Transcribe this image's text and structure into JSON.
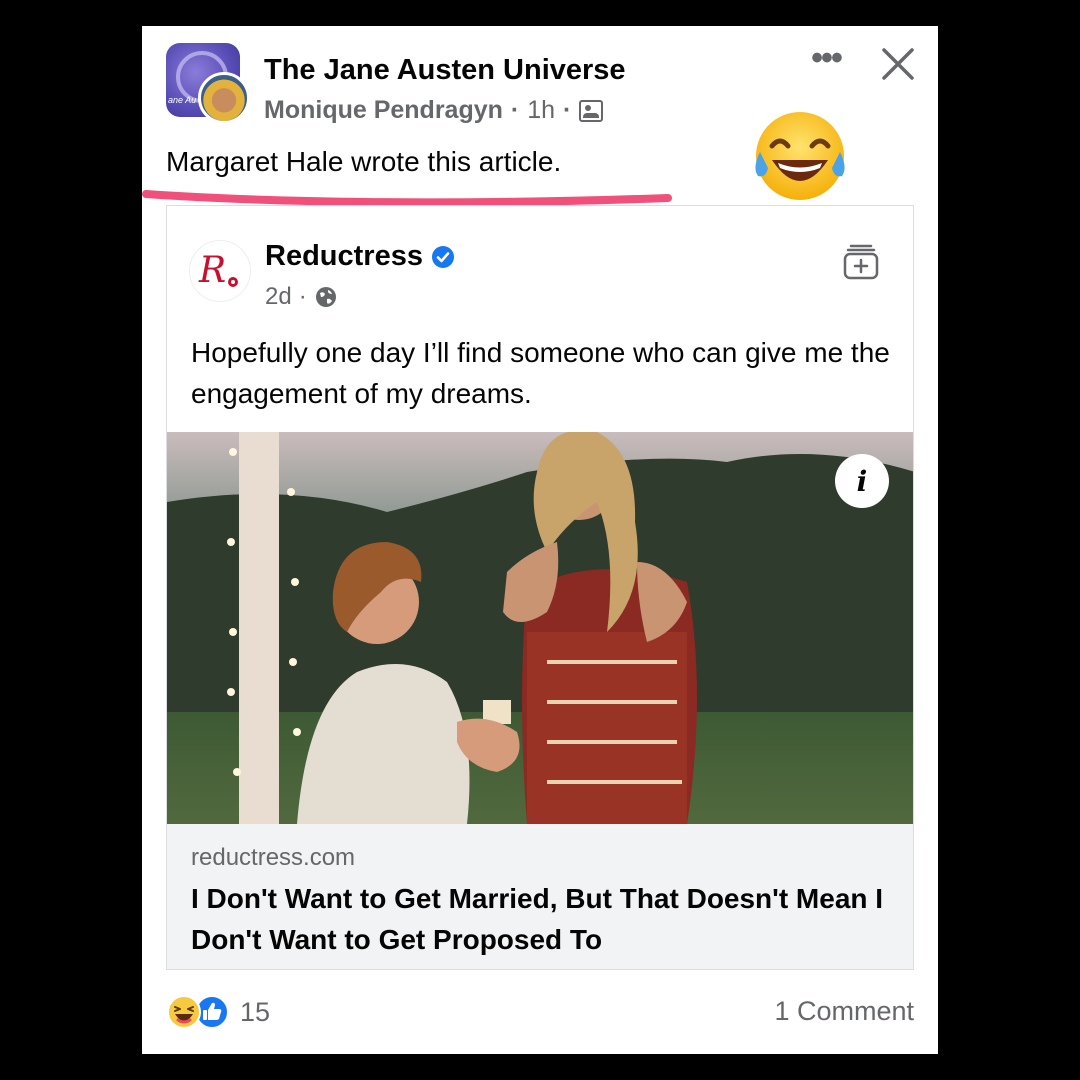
{
  "post": {
    "group_name": "The Jane Austen Universe",
    "author": "Monique Pendragyn",
    "time": "1h",
    "separator": "·",
    "text": "Margaret Hale wrote this article.",
    "group_avatar_label": "ane Au"
  },
  "shared_post": {
    "page_name": "Reductress",
    "time": "2d",
    "separator": "·",
    "caption": "Hopefully one day I’ll find someone who can give me the engagement of my dreams.",
    "logo_letter": "R"
  },
  "link": {
    "domain": "reductress.com",
    "title": "I Don't Want to Get Married, But That Doesn't Mean I Don't Want to Get Proposed To"
  },
  "footer": {
    "reaction_count": "15",
    "comment_count": "1 Comment"
  },
  "icons": {
    "more": "more-icon",
    "close": "close-icon",
    "members": "members-icon",
    "verified": "verified-icon",
    "globe": "globe-icon",
    "save": "save-icon",
    "info": "info-icon",
    "haha": "haha-reaction-icon",
    "like": "like-reaction-icon",
    "laugh_emoji": "tears-of-joy-emoji"
  },
  "colors": {
    "underline": "#f0507a",
    "verified": "#1877f2",
    "brand_red": "#c8102e",
    "text_primary": "#050505",
    "text_secondary": "#65676b"
  }
}
